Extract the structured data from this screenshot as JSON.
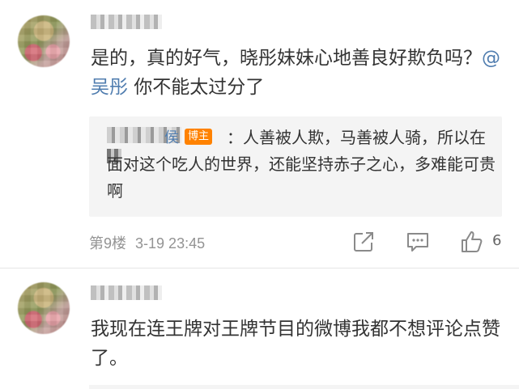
{
  "comments": [
    {
      "text_prefix": "是的，真的好气，晓彤妹妹心地善良好欺负吗？",
      "mention": "@吴彤",
      "text_suffix": " 你不能太过分了",
      "reply": {
        "name_tail": "侯",
        "badge": "博主",
        "text": "：人善被人欺，马善被人骑，所以在面对这个吃人的世界，还能坚持赤子之心，多难能可贵啊"
      },
      "floor": "第9楼",
      "time": "3-19 23:45",
      "like_count": "6"
    },
    {
      "text": "我现在连王牌对王牌节目的微博我都不想评论点赞了。"
    }
  ],
  "icons": {
    "share": "share-icon",
    "comment": "comment-icon",
    "like": "thumbs-up-icon"
  },
  "colors": {
    "mention": "#507daf",
    "badge": "#ff8200",
    "meta": "#939393",
    "reply_bg": "#f4f4f4"
  }
}
